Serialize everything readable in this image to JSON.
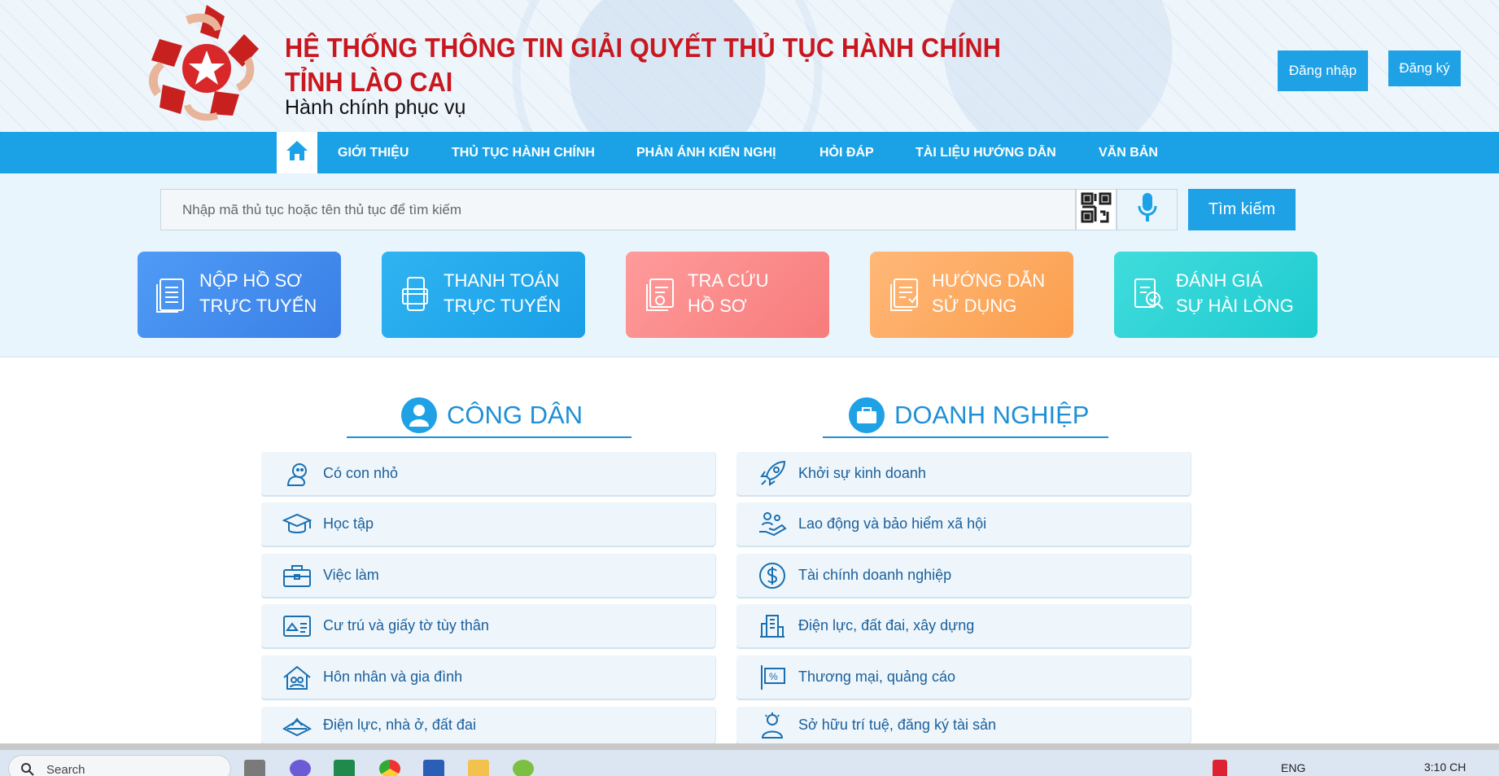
{
  "header": {
    "title_line1": "HỆ THỐNG THÔNG TIN GIẢI QUYẾT THỦ TỤC HÀNH CHÍNH",
    "title_line2": "TỈNH LÀO CAI",
    "slogan": "Hành chính phục vụ",
    "login_label": "Đăng nhập",
    "register_label": "Đăng ký"
  },
  "nav": {
    "items": [
      "GIỚI THIỆU",
      "THỦ TỤC HÀNH CHÍNH",
      "PHẢN ÁNH KIẾN NGHỊ",
      "HỎI ĐÁP",
      "TÀI LIỆU HƯỚNG DẪN",
      "VĂN BẢN"
    ]
  },
  "search": {
    "placeholder": "Nhập mã thủ tục hoặc tên thủ tục để tìm kiếm",
    "button_label": "Tìm kiếm"
  },
  "quick_cards": [
    {
      "line1": "NỘP HỒ SƠ",
      "line2": "TRỰC TUYẾN"
    },
    {
      "line1": "THANH TOÁN",
      "line2": "TRỰC TUYẾN"
    },
    {
      "line1": "TRA CỨU",
      "line2": "HỒ SƠ"
    },
    {
      "line1": "HƯỚNG DẪN",
      "line2": "SỬ DỤNG"
    },
    {
      "line1": "ĐÁNH GIÁ",
      "line2": "SỰ HÀI LÒNG"
    }
  ],
  "citizen": {
    "heading": "CÔNG DÂN",
    "items": [
      "Có con nhỏ",
      "Học tập",
      "Việc làm",
      "Cư trú và giấy tờ tùy thân",
      "Hôn nhân và gia đình",
      "Điện lực, nhà ở, đất đai"
    ]
  },
  "business": {
    "heading": "DOANH NGHIỆP",
    "items": [
      "Khởi sự kinh doanh",
      "Lao động và bảo hiểm xã hội",
      "Tài chính doanh nghiệp",
      "Điện lực, đất đai, xây dựng",
      "Thương mại, quảng cáo",
      "Sở hữu trí tuệ, đăng ký tài sản"
    ]
  },
  "taskbar": {
    "search_label": "Search",
    "lang": "ENG",
    "time": "3:10 CH"
  },
  "colors": {
    "brand_blue": "#1ba2e6",
    "title_red": "#c8171e"
  }
}
